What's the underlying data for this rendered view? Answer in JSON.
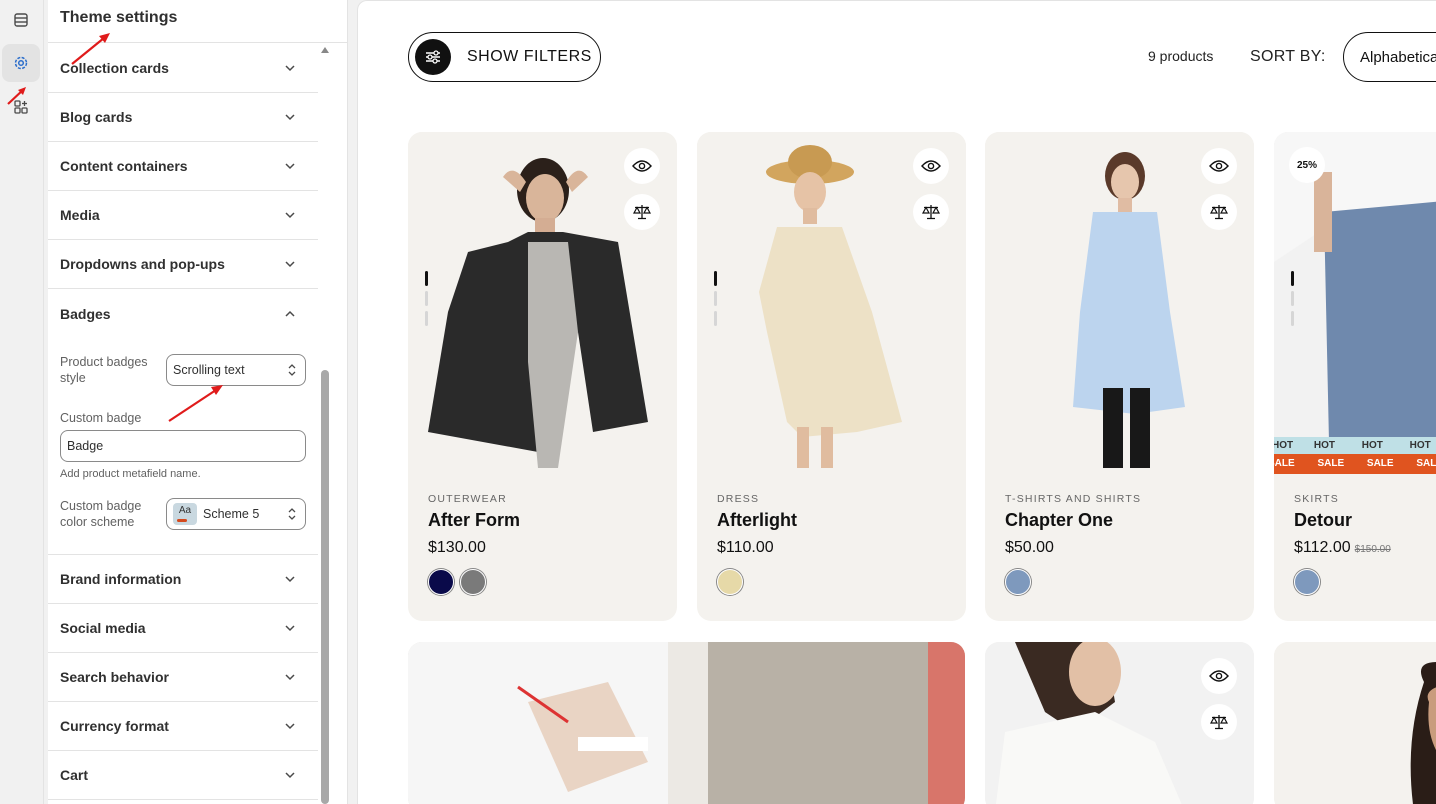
{
  "panel": {
    "title": "Theme settings",
    "sections_top": [
      "Collection cards",
      "Blog cards",
      "Content containers",
      "Media",
      "Dropdowns and pop-ups"
    ],
    "badges": {
      "title": "Badges",
      "product_badges_style_label": "Product badges style",
      "product_badges_style_value": "Scrolling text",
      "custom_badge_label": "Custom badge",
      "custom_badge_value": "Badge",
      "custom_badge_help": "Add product metafield name.",
      "color_scheme_label": "Custom badge color scheme",
      "color_scheme_swatch": "Aa",
      "color_scheme_value": "Scheme 5"
    },
    "sections_bottom": [
      "Brand information",
      "Social media",
      "Search behavior",
      "Currency format",
      "Cart"
    ]
  },
  "toolbar": {
    "filters_label": "SHOW FILTERS",
    "product_count": "9 products",
    "sort_label": "SORT BY:",
    "sort_value": "Alphabetica"
  },
  "products": [
    {
      "category": "OUTERWEAR",
      "name": "After Form",
      "price": "$130.00",
      "colors": [
        "#0a0a4a",
        "#7a7a7a"
      ]
    },
    {
      "category": "DRESS",
      "name": "Afterlight",
      "price": "$110.00",
      "colors": [
        "#e6d9a8"
      ]
    },
    {
      "category": "T-SHIRTS AND SHIRTS",
      "name": "Chapter One",
      "price": "$50.00",
      "colors": [
        "#7e99bd"
      ]
    },
    {
      "category": "SKIRTS",
      "name": "Detour",
      "price": "$112.00",
      "old_price": "$150.00",
      "discount": "25%",
      "colors": [
        "#7e99bd"
      ]
    }
  ],
  "badge_marquee": {
    "hot": "HOT",
    "sale": "SALE"
  },
  "icons": [
    "sections-icon",
    "gear-icon",
    "apps-icon",
    "filter-sliders-icon",
    "eye-icon",
    "compare-scale-icon",
    "chevron-down-icon",
    "chevron-up-icon",
    "select-stepper-icon"
  ]
}
